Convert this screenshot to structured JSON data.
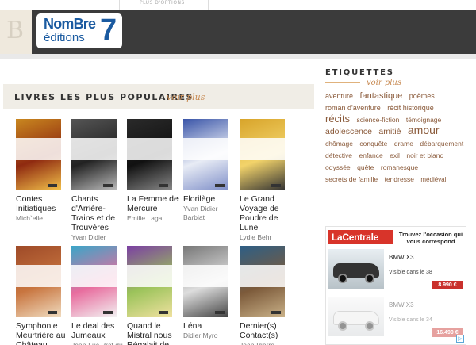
{
  "top": {
    "tab_label": "PLUS D'OPTIONS"
  },
  "header": {
    "bmark": "B",
    "logo_line1": "NomBre",
    "logo_line2": "éditions",
    "logo_number": "7"
  },
  "popular": {
    "title": "LIVRES LES PLUS POPULAIRES",
    "more": "voir plus",
    "books": [
      {
        "title": "Contes Initiatiques",
        "author": "Mich`elle",
        "cover": [
          "#c9871f",
          "#8f2a10",
          "#f2c14a"
        ]
      },
      {
        "title": "Chants d'Arrière-Trains et de Trouvères",
        "author": "Yvan Didier",
        "cover": [
          "#555",
          "#222",
          "#bbb"
        ]
      },
      {
        "title": "La Femme de Mercure",
        "author": "Emilie Lagat",
        "cover": [
          "#2a2a2a",
          "#111",
          "#888"
        ]
      },
      {
        "title": "Florilège",
        "author": "Yvan Didier Barbiat",
        "cover": [
          "#3a55a8",
          "#e8ecf5",
          "#7e8ec8"
        ]
      },
      {
        "title": "Le Grand Voyage de Poudre de Lune",
        "author": "Lydie Behr",
        "cover": [
          "#d8a42a",
          "#f2d36a",
          "#333"
        ]
      },
      {
        "title": "Symphonie Meurtrière au Château",
        "author": "",
        "cover": [
          "#9e4a28",
          "#c8753f",
          "#f0dcc0"
        ]
      },
      {
        "title": "Le deal des Jumeaux",
        "author": "Jean-Luc Prat du",
        "cover": [
          "#3aa6c8",
          "#e86d9e",
          "#f2f2f2"
        ]
      },
      {
        "title": "Quand le Mistral nous Régalait de",
        "author": "",
        "cover": [
          "#7b3fa3",
          "#9bc35a",
          "#f0e1a0"
        ]
      },
      {
        "title": "Léna",
        "author": "Didier Myro",
        "cover": [
          "#777",
          "#ddd",
          "#444"
        ]
      },
      {
        "title": "Dernier(s) Contact(s)",
        "author": "Jean-Pierre",
        "cover": [
          "#2d5f86",
          "#7c5a3a",
          "#c9b188"
        ]
      }
    ]
  },
  "tags": {
    "title": "ETIQUETTES",
    "more": "voir plus",
    "items": [
      {
        "label": "aventure",
        "size": 9
      },
      {
        "label": "fantastique",
        "size": 11
      },
      {
        "label": "poèmes",
        "size": 9
      },
      {
        "label": "roman d'aventure",
        "size": 9
      },
      {
        "label": "récit historique",
        "size": 9
      },
      {
        "label": "récits",
        "size": 13
      },
      {
        "label": "science-fiction",
        "size": 8.5
      },
      {
        "label": "témoignage",
        "size": 8.5
      },
      {
        "label": "adolescence",
        "size": 10.5
      },
      {
        "label": "amitié",
        "size": 10.5
      },
      {
        "label": "amour",
        "size": 14
      },
      {
        "label": "chômage",
        "size": 8.5
      },
      {
        "label": "conquête",
        "size": 8.5
      },
      {
        "label": "drame",
        "size": 8.5
      },
      {
        "label": "débarquement",
        "size": 8.5
      },
      {
        "label": "détective",
        "size": 8.5
      },
      {
        "label": "enfance",
        "size": 8.5
      },
      {
        "label": "exil",
        "size": 8.5
      },
      {
        "label": "noir et blanc",
        "size": 8.5
      },
      {
        "label": "odyssée",
        "size": 8.5
      },
      {
        "label": "quête",
        "size": 8.5
      },
      {
        "label": "romanesque",
        "size": 8.5
      },
      {
        "label": "secrets de famille",
        "size": 8.5
      },
      {
        "label": "tendresse",
        "size": 8.5
      },
      {
        "label": "médiéval",
        "size": 8
      }
    ]
  },
  "ad": {
    "brand": "LaCentrale",
    "tagline": "Trouvez l'occasion qui vous correspond",
    "items": [
      {
        "model": "BMW X3",
        "location": "Visible dans le 38",
        "price": "8.990 €"
      },
      {
        "model": "BMW X3",
        "location": "Visible dans le 34",
        "price": "16.490 €"
      }
    ],
    "choices_icon": "adchoices-icon"
  }
}
